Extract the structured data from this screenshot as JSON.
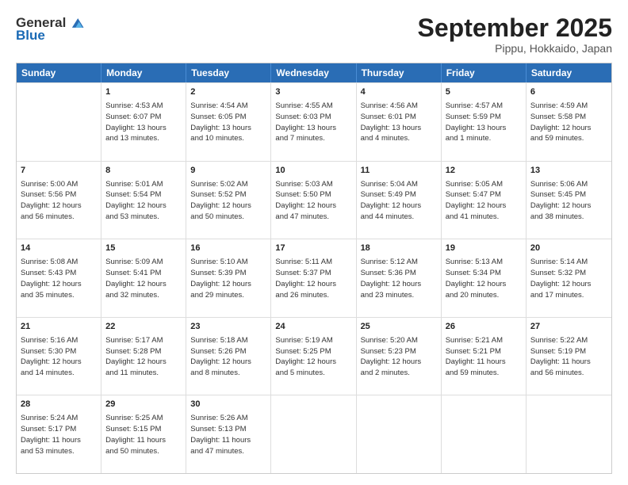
{
  "header": {
    "logo_general": "General",
    "logo_blue": "Blue",
    "month_title": "September 2025",
    "location": "Pippu, Hokkaido, Japan"
  },
  "days_of_week": [
    "Sunday",
    "Monday",
    "Tuesday",
    "Wednesday",
    "Thursday",
    "Friday",
    "Saturday"
  ],
  "weeks": [
    [
      {
        "day": "",
        "info": ""
      },
      {
        "day": "1",
        "info": "Sunrise: 4:53 AM\nSunset: 6:07 PM\nDaylight: 13 hours\nand 13 minutes."
      },
      {
        "day": "2",
        "info": "Sunrise: 4:54 AM\nSunset: 6:05 PM\nDaylight: 13 hours\nand 10 minutes."
      },
      {
        "day": "3",
        "info": "Sunrise: 4:55 AM\nSunset: 6:03 PM\nDaylight: 13 hours\nand 7 minutes."
      },
      {
        "day": "4",
        "info": "Sunrise: 4:56 AM\nSunset: 6:01 PM\nDaylight: 13 hours\nand 4 minutes."
      },
      {
        "day": "5",
        "info": "Sunrise: 4:57 AM\nSunset: 5:59 PM\nDaylight: 13 hours\nand 1 minute."
      },
      {
        "day": "6",
        "info": "Sunrise: 4:59 AM\nSunset: 5:58 PM\nDaylight: 12 hours\nand 59 minutes."
      }
    ],
    [
      {
        "day": "7",
        "info": "Sunrise: 5:00 AM\nSunset: 5:56 PM\nDaylight: 12 hours\nand 56 minutes."
      },
      {
        "day": "8",
        "info": "Sunrise: 5:01 AM\nSunset: 5:54 PM\nDaylight: 12 hours\nand 53 minutes."
      },
      {
        "day": "9",
        "info": "Sunrise: 5:02 AM\nSunset: 5:52 PM\nDaylight: 12 hours\nand 50 minutes."
      },
      {
        "day": "10",
        "info": "Sunrise: 5:03 AM\nSunset: 5:50 PM\nDaylight: 12 hours\nand 47 minutes."
      },
      {
        "day": "11",
        "info": "Sunrise: 5:04 AM\nSunset: 5:49 PM\nDaylight: 12 hours\nand 44 minutes."
      },
      {
        "day": "12",
        "info": "Sunrise: 5:05 AM\nSunset: 5:47 PM\nDaylight: 12 hours\nand 41 minutes."
      },
      {
        "day": "13",
        "info": "Sunrise: 5:06 AM\nSunset: 5:45 PM\nDaylight: 12 hours\nand 38 minutes."
      }
    ],
    [
      {
        "day": "14",
        "info": "Sunrise: 5:08 AM\nSunset: 5:43 PM\nDaylight: 12 hours\nand 35 minutes."
      },
      {
        "day": "15",
        "info": "Sunrise: 5:09 AM\nSunset: 5:41 PM\nDaylight: 12 hours\nand 32 minutes."
      },
      {
        "day": "16",
        "info": "Sunrise: 5:10 AM\nSunset: 5:39 PM\nDaylight: 12 hours\nand 29 minutes."
      },
      {
        "day": "17",
        "info": "Sunrise: 5:11 AM\nSunset: 5:37 PM\nDaylight: 12 hours\nand 26 minutes."
      },
      {
        "day": "18",
        "info": "Sunrise: 5:12 AM\nSunset: 5:36 PM\nDaylight: 12 hours\nand 23 minutes."
      },
      {
        "day": "19",
        "info": "Sunrise: 5:13 AM\nSunset: 5:34 PM\nDaylight: 12 hours\nand 20 minutes."
      },
      {
        "day": "20",
        "info": "Sunrise: 5:14 AM\nSunset: 5:32 PM\nDaylight: 12 hours\nand 17 minutes."
      }
    ],
    [
      {
        "day": "21",
        "info": "Sunrise: 5:16 AM\nSunset: 5:30 PM\nDaylight: 12 hours\nand 14 minutes."
      },
      {
        "day": "22",
        "info": "Sunrise: 5:17 AM\nSunset: 5:28 PM\nDaylight: 12 hours\nand 11 minutes."
      },
      {
        "day": "23",
        "info": "Sunrise: 5:18 AM\nSunset: 5:26 PM\nDaylight: 12 hours\nand 8 minutes."
      },
      {
        "day": "24",
        "info": "Sunrise: 5:19 AM\nSunset: 5:25 PM\nDaylight: 12 hours\nand 5 minutes."
      },
      {
        "day": "25",
        "info": "Sunrise: 5:20 AM\nSunset: 5:23 PM\nDaylight: 12 hours\nand 2 minutes."
      },
      {
        "day": "26",
        "info": "Sunrise: 5:21 AM\nSunset: 5:21 PM\nDaylight: 11 hours\nand 59 minutes."
      },
      {
        "day": "27",
        "info": "Sunrise: 5:22 AM\nSunset: 5:19 PM\nDaylight: 11 hours\nand 56 minutes."
      }
    ],
    [
      {
        "day": "28",
        "info": "Sunrise: 5:24 AM\nSunset: 5:17 PM\nDaylight: 11 hours\nand 53 minutes."
      },
      {
        "day": "29",
        "info": "Sunrise: 5:25 AM\nSunset: 5:15 PM\nDaylight: 11 hours\nand 50 minutes."
      },
      {
        "day": "30",
        "info": "Sunrise: 5:26 AM\nSunset: 5:13 PM\nDaylight: 11 hours\nand 47 minutes."
      },
      {
        "day": "",
        "info": ""
      },
      {
        "day": "",
        "info": ""
      },
      {
        "day": "",
        "info": ""
      },
      {
        "day": "",
        "info": ""
      }
    ]
  ]
}
